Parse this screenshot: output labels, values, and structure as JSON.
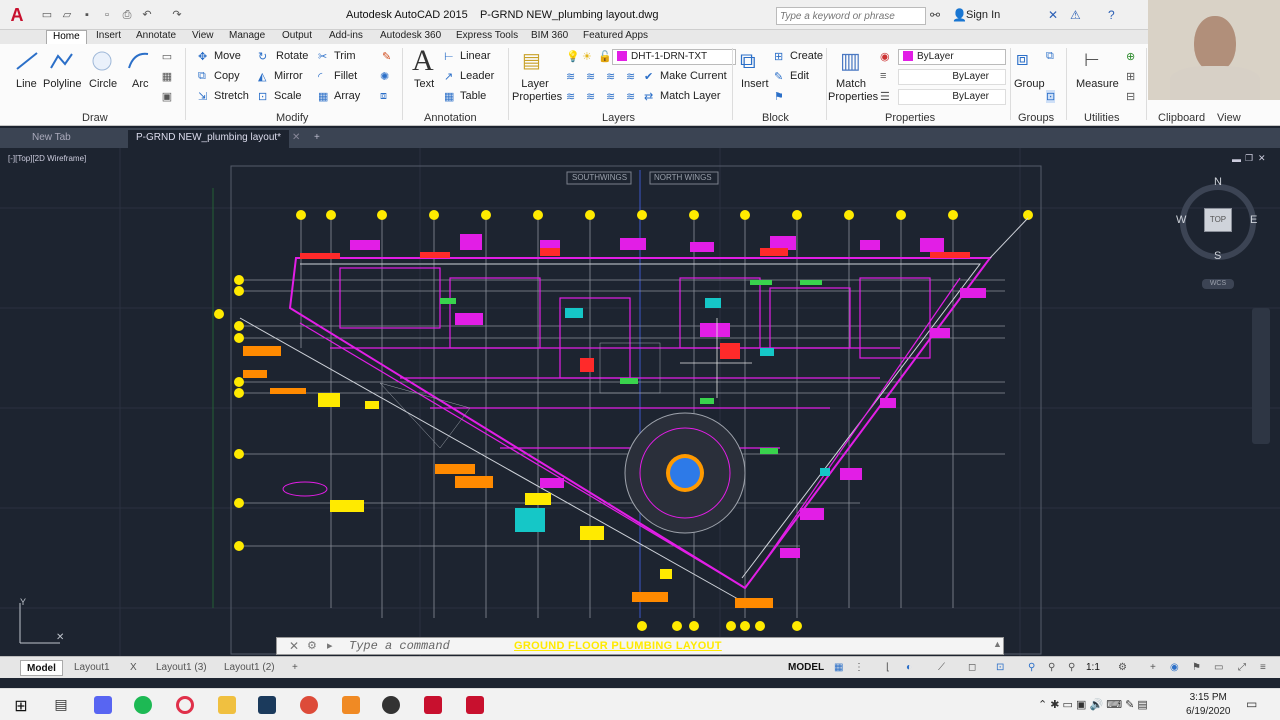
{
  "titlebar": {
    "app": "Autodesk AutoCAD 2015",
    "file": "P-GRND NEW_plumbing layout.dwg",
    "search_placeholder": "Type a keyword or phrase",
    "signin": "Sign In"
  },
  "ribbon_tabs": [
    "Home",
    "Insert",
    "Annotate",
    "View",
    "Manage",
    "Output",
    "Add-ins",
    "Autodesk 360",
    "Express Tools",
    "BIM 360",
    "Featured Apps"
  ],
  "draw": {
    "line": "Line",
    "polyline": "Polyline",
    "circle": "Circle",
    "arc": "Arc",
    "title": "Draw"
  },
  "modify": {
    "move": "Move",
    "rotate": "Rotate",
    "trim": "Trim",
    "copy": "Copy",
    "mirror": "Mirror",
    "fillet": "Fillet",
    "stretch": "Stretch",
    "scale": "Scale",
    "array": "Array",
    "title": "Modify"
  },
  "annotation": {
    "text": "Text",
    "linear": "Linear",
    "leader": "Leader",
    "table": "Table",
    "title": "Annotation"
  },
  "layers": {
    "layer_properties": "Layer Properties",
    "current_layer": "DHT-1-DRN-TXT",
    "make_current": "Make Current",
    "match_layer": "Match Layer",
    "title": "Layers"
  },
  "block": {
    "insert": "Insert",
    "create": "Create",
    "edit": "Edit",
    "title": "Block"
  },
  "properties": {
    "match": "Match Properties",
    "bylayer1": "ByLayer",
    "bylayer2": "ByLayer",
    "bylayer3": "ByLayer",
    "title": "Properties"
  },
  "groups": {
    "group": "Group",
    "title": "Groups"
  },
  "utilities": {
    "measure": "Measure",
    "title": "Utilities"
  },
  "clipboard": {
    "title": "Clipboard"
  },
  "viewpanel": {
    "title": "View"
  },
  "doc_tabs": [
    "New Tab",
    "P-GRND NEW_plumbing layout*"
  ],
  "viewport_label": "[-][Top][2D Wireframe]",
  "compass": {
    "n": "N",
    "s": "S",
    "e": "E",
    "w": "W",
    "top": "TOP",
    "wcs": "WCS"
  },
  "wing_labels": [
    "SOUTHWINGS",
    "NORTH WINGS"
  ],
  "drawing_title": "GROUND FLOOR PLUMBING LAYOUT",
  "command_placeholder": "Type a command",
  "layout_tabs": [
    "Model",
    "Layout1",
    "X",
    "Layout1 (3)",
    "Layout1 (2)"
  ],
  "status": {
    "model": "MODEL",
    "scale": "1:1"
  },
  "clock": {
    "time": "3:15 PM",
    "date": "6/19/2020"
  },
  "colors": {
    "magenta": "#e21ee6",
    "yellow": "#ffea00",
    "cyan": "#15c7c7",
    "green": "#39d34d",
    "grid": "#4a5264",
    "orange": "#ff8a00",
    "red": "#ff2a2a"
  }
}
